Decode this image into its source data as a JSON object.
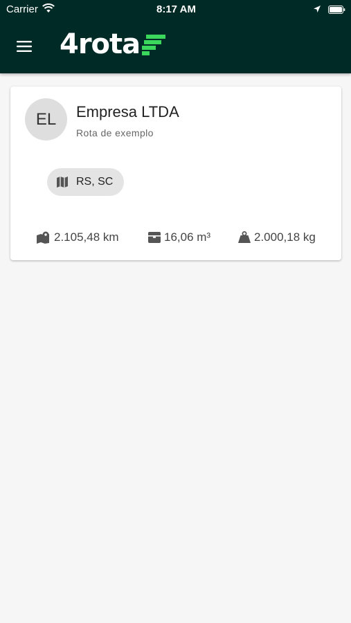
{
  "status_bar": {
    "carrier": "Carrier",
    "time": "8:17 AM"
  },
  "header": {
    "logo_text": "4rota",
    "colors": {
      "background": "#002a25",
      "accent": "#3bd65c"
    }
  },
  "route_card": {
    "avatar_initials": "EL",
    "company_name": "Empresa LTDA",
    "route_name": "Rota de exemplo",
    "states_chip": {
      "label": "RS, SC",
      "icon": "map-icon"
    },
    "stats": [
      {
        "icon": "map-route-icon",
        "value": "2.105,48 km"
      },
      {
        "icon": "box-icon",
        "value": "16,06 m³"
      },
      {
        "icon": "weight-icon",
        "value": "2.000,18 kg"
      }
    ]
  }
}
